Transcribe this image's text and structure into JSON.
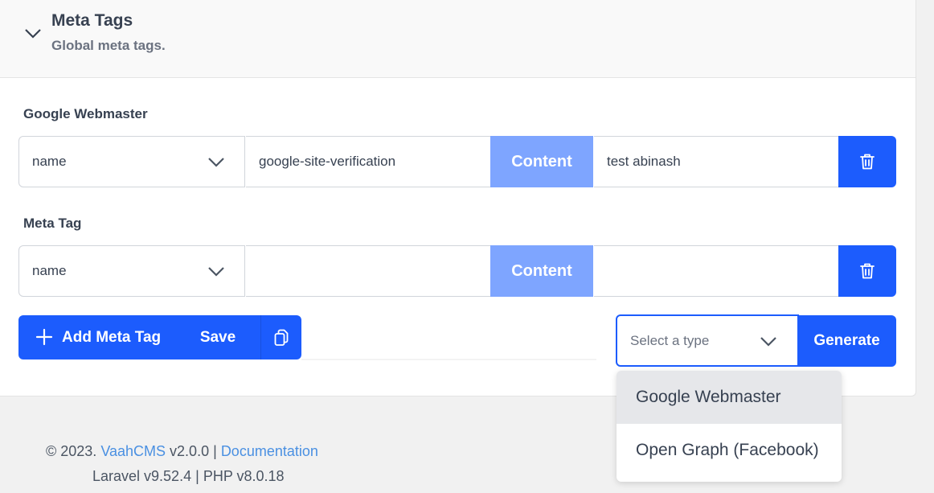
{
  "header": {
    "title": "Meta Tags",
    "subtitle": "Global meta tags."
  },
  "rows": [
    {
      "label": "Google Webmaster",
      "attribute": "name",
      "attribute_value": "google-site-verification",
      "content_label": "Content",
      "content_value": "test abinash"
    },
    {
      "label": "Meta Tag",
      "attribute": "name",
      "attribute_value": "",
      "content_label": "Content",
      "content_value": ""
    }
  ],
  "actions": {
    "add_label": "Add Meta Tag",
    "save_label": "Save"
  },
  "type_select": {
    "placeholder": "Select a type",
    "generate_label": "Generate",
    "options": [
      "Google Webmaster",
      "Open Graph (Facebook)"
    ],
    "highlighted_option": "Google Webmaster"
  },
  "footer": {
    "copyright": "© 2023.",
    "app_name": "VaahCMS",
    "version": "v2.0.0",
    "separator": "|",
    "documentation": "Documentation",
    "laravel": "Laravel v9.52.4",
    "php": "PHP v8.0.18"
  },
  "colors": {
    "primary": "#1c5cfd",
    "content_button": "#7ea5ff",
    "link": "#4a90e2"
  }
}
